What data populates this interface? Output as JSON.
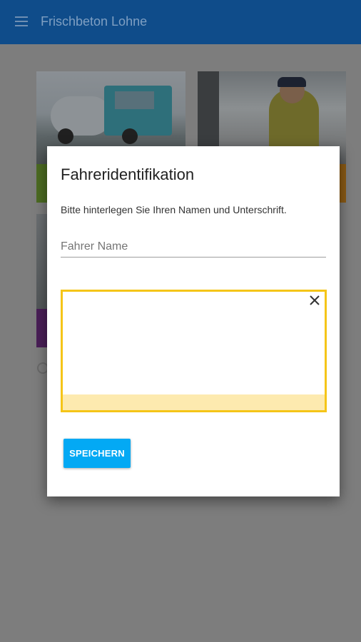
{
  "app": {
    "title": "Frischbeton Lohne",
    "menu_icon": "menu-icon",
    "bar_color": "#0f4c8a"
  },
  "dialog": {
    "title": "Fahreridentifikation",
    "instruction": "Bitte hinterlegen Sie Ihren Namen und Unterschrift.",
    "name_field": {
      "placeholder": "Fahrer Name",
      "value": ""
    },
    "signature_pad": {
      "clear_icon": "close-icon",
      "border_color": "#f5c518"
    },
    "save_label": "SPEICHERN",
    "save_color": "#03a9f4"
  }
}
